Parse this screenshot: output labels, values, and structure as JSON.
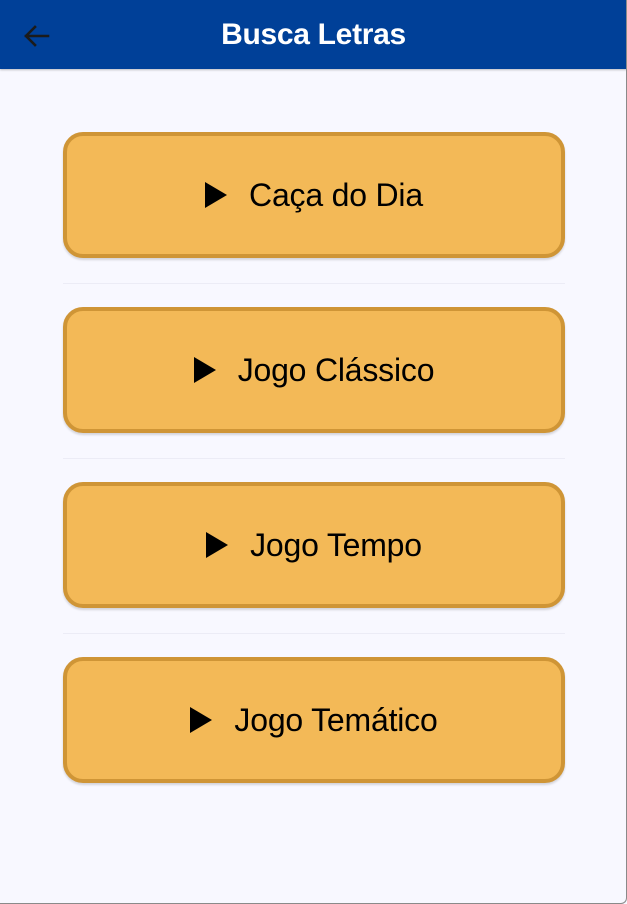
{
  "header": {
    "title": "Busca Letras",
    "back_icon": "arrow-left-icon"
  },
  "menu": {
    "buttons": [
      {
        "label": "Caça do Dia",
        "icon": "play-icon"
      },
      {
        "label": "Jogo Clássico",
        "icon": "play-icon"
      },
      {
        "label": "Jogo Tempo",
        "icon": "play-icon"
      },
      {
        "label": "Jogo Temático",
        "icon": "play-icon"
      }
    ]
  },
  "colors": {
    "header_background": "#004098",
    "page_background": "#f8f8ff",
    "button_fill": "#f3b957",
    "button_border": "#cf9536",
    "text_dark": "#000000",
    "text_light": "#ffffff"
  }
}
